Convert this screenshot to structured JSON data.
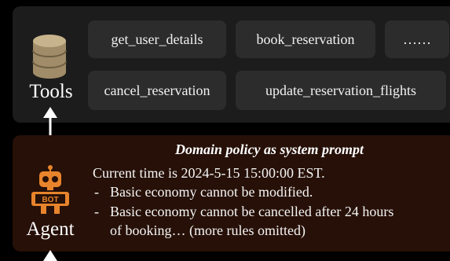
{
  "tools": {
    "label": "Tools",
    "items": [
      {
        "label": "get_user_details"
      },
      {
        "label": "book_reservation"
      },
      {
        "label": "……"
      },
      {
        "label": "cancel_reservation"
      },
      {
        "label": "update_reservation_flights"
      }
    ]
  },
  "agent": {
    "label": "Agent",
    "robot_badge": "BOT"
  },
  "policy": {
    "title": "Domain policy as system prompt",
    "current_time": "Current time is 2024-5-15 15:00:00 EST.",
    "rules": [
      {
        "dash": "-",
        "lines": [
          "Basic economy cannot be modified."
        ]
      },
      {
        "dash": "-",
        "lines": [
          "Basic economy cannot be cancelled after 24 hours",
          "of booking… (more rules omitted)"
        ]
      }
    ]
  },
  "colors": {
    "page_background": "#000000",
    "tools_panel": "#1c1c1c",
    "tool_button": "#2c2c2c",
    "agent_panel": "#261007",
    "robot_orange": "#e8842c",
    "database_tan": "#c8b48c"
  },
  "icons": [
    "database-icon",
    "robot-icon",
    "double-arrow-icon"
  ]
}
